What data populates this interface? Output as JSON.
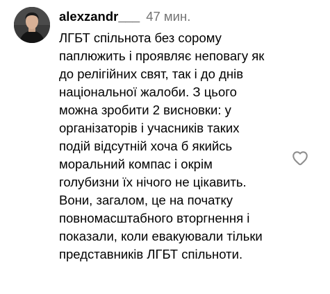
{
  "comment": {
    "username": "alexzandr___",
    "timestamp": "47 мин.",
    "lines": [
      "ЛГБТ спільнота без сорому",
      "паплюжить і проявляє неповагу як",
      "до релігійних свят, так і до днів",
      "національної жалоби. З цього",
      "можна зробити 2 висновки: у",
      "організаторів і учасників таких",
      "подій відсутній хоча б якийсь",
      "моральний компас і окрім",
      "голубизни їх нічого не цікавить.",
      "Вони, загалом, це на початку",
      "повномасштабного вторгнення і",
      "показали, коли евакуювали тільки",
      "представників ЛГБТ спільноти."
    ],
    "like_icon": "heart-outline-icon"
  },
  "colors": {
    "text": "#000000",
    "secondary_text": "#737373",
    "icon": "#8e8e8e",
    "background": "#ffffff"
  }
}
